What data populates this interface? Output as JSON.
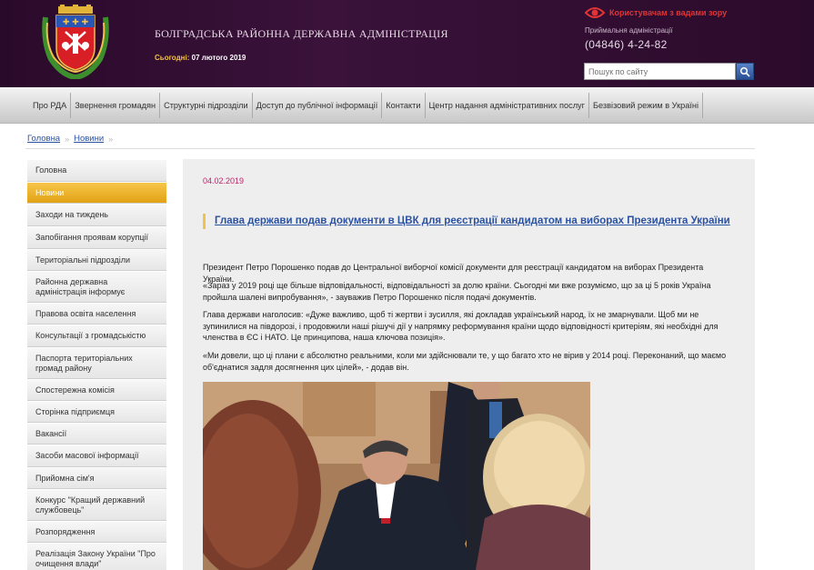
{
  "header": {
    "site_title": "БОЛГРАДСЬКА РАЙОННА ДЕРЖАВНА АДМІНІСТРАЦІЯ",
    "today_label": "Сьогодні:",
    "today_value": "07 лютого 2019",
    "vision_link": "Користувачам з вадами зору",
    "reception_label": "Приймальня адміністрації",
    "phone": "(04846) 4-24-82",
    "search_placeholder": "Пошук по сайту"
  },
  "nav": {
    "items": [
      "Про РДА",
      "Звернення громадян",
      "Структурні підрозділи",
      "Доступ до публічної інформації",
      "Контакти",
      "Центр надання адміністративних послуг",
      "Безвізовий режим в Україні"
    ]
  },
  "breadcrumb": {
    "home": "Головна",
    "current": "Новини",
    "sep": "»"
  },
  "sidebar": {
    "items": [
      "Головна",
      "Новини",
      "Заходи на тиждень",
      "Запобігання проявам корупції",
      "Територіальні підрозділи",
      "Районна державна адміністрація інформує",
      "Правова освіта населення",
      "Консультації з громадськістю",
      "Паспорта територіальних громад району",
      "Спостережна комісія",
      "Сторінка підприємця",
      "Вакансії",
      "Засоби масової інформації",
      "Прийомна сім'я",
      "Конкурс \"Кращий державний службовець\"",
      "Розпорядження",
      "Реалізація Закону України \"Про очищення влади\""
    ],
    "active_index": 1
  },
  "article": {
    "date": "04.02.2019",
    "title": "Глава держави подав документи в ЦВК для реєстрації кандидатом на виборах Президента України",
    "paragraphs": [
      "Президент Петро Порошенко подав до Центральної виборчої комісії документи для реєстрації кандидатом на виборах Президента України.",
      "«Зараз у 2019 році ще більше відповідальності, відповідальності за долю країни. Сьогодні ми вже розуміємо, що за ці 5 років Україна пройшла шалені випробування», - зауважив Петро Порошенко після подачі документів.",
      "Глава держави наголосив: «Дуже важливо, щоб ті жертви і зусилля, які докладав український народ, їх не змарнували. Щоб ми не зупинилися на півдорозі, і продовжили наші рішучі дії у напрямку реформування країни щодо відповідності критеріям, які необхідні для членства в ЄС і НАТО. Це принципова, наша ключова позиція».",
      "«Ми довели, що ці плани є абсолютно реальними, коли ми здійснювали те, у що багато хто не вірив у 2014 році. Переконаний, що маємо об'єднатися задля досягнення цих цілей», - додав він."
    ]
  },
  "colors": {
    "header_bg": "#2b0b2b",
    "active_menu": "#e9ab1d",
    "link": "#2a52a3",
    "date": "#c0226a",
    "vision": "#e23434"
  }
}
